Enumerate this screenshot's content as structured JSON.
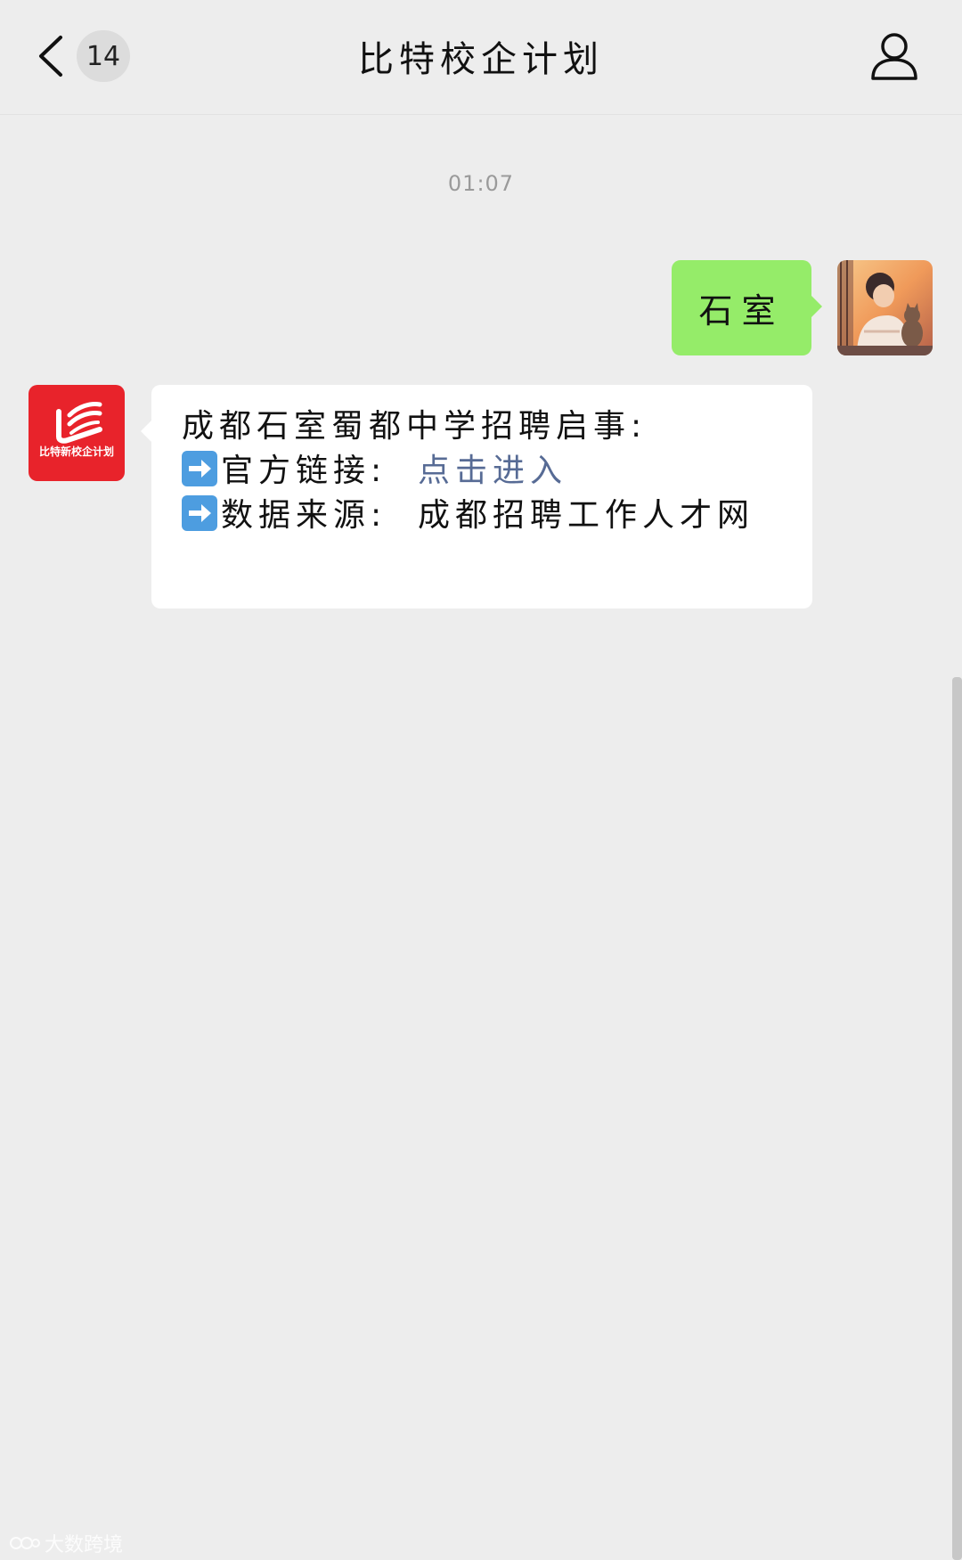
{
  "header": {
    "title": "比特校企计划",
    "unread_count": "14",
    "back_icon": "chevron-left-icon",
    "profile_icon": "person-outline-icon"
  },
  "chat": {
    "timestamp": "01:07",
    "sent_message": "石室",
    "sender_logo_text": "比特新校企计划",
    "received": {
      "line1": "成都石室蜀都中学招聘启事:",
      "line2_label": "官方链接:",
      "line2_link": "点击进入",
      "line3_label": "数据来源:",
      "line3_value": "成都招聘工作人才网"
    }
  },
  "watermark": {
    "text": "大数跨境"
  },
  "colors": {
    "background": "#ededed",
    "sent_bubble": "#95ec69",
    "received_bubble": "#ffffff",
    "link": "#576b95",
    "brand_red": "#e8232b"
  }
}
